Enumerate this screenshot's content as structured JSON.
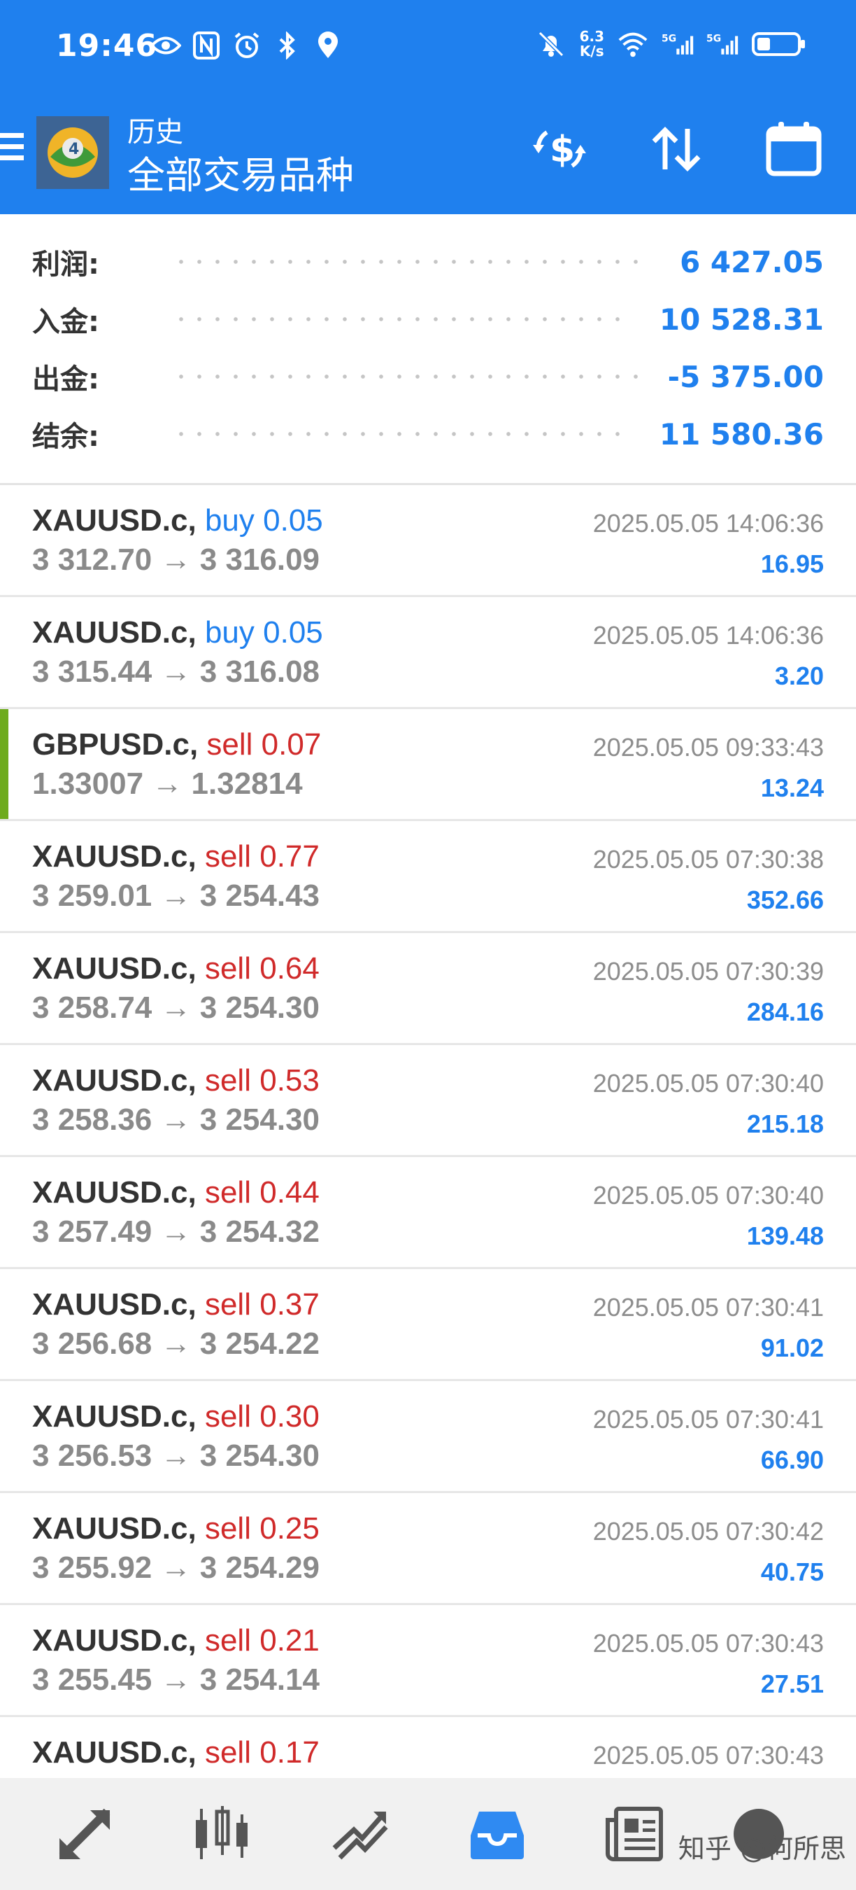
{
  "status_bar": {
    "time": "19:46",
    "left_icons": [
      "eye-icon",
      "nfc-icon",
      "alarm-icon",
      "bluetooth-icon",
      "location-icon"
    ],
    "network_speed": {
      "value": "6.3",
      "unit": "K/s"
    },
    "right_icons": [
      "mute-icon",
      "wifi-icon",
      "signal-5g-icon",
      "signal-5g-icon",
      "battery-icon"
    ]
  },
  "app_bar": {
    "title": "历史",
    "subtitle": "全部交易品种",
    "actions": [
      "currency-exchange-icon",
      "sort-icon",
      "calendar-icon"
    ]
  },
  "summary": [
    {
      "label": "利润:",
      "value": "6 427.05"
    },
    {
      "label": "入金:",
      "value": "10 528.31"
    },
    {
      "label": "出金:",
      "value": "-5 375.00"
    },
    {
      "label": "结余:",
      "value": "11 580.36"
    }
  ],
  "trades": [
    {
      "symbol": "XAUUSD.c,",
      "side": "buy",
      "volume": "0.05",
      "open": "3 312.70",
      "arrow": "→",
      "close": "3 316.09",
      "time": "2025.05.05 14:06:36",
      "profit": "16.95"
    },
    {
      "symbol": "XAUUSD.c,",
      "side": "buy",
      "volume": "0.05",
      "open": "3 315.44",
      "arrow": "→",
      "close": "3 316.08",
      "time": "2025.05.05 14:06:36",
      "profit": "3.20"
    },
    {
      "symbol": "GBPUSD.c,",
      "side": "sell",
      "volume": "0.07",
      "open": "1.33007",
      "arrow": "→",
      "close": "1.32814",
      "time": "2025.05.05 09:33:43",
      "profit": "13.24",
      "highlighted": true
    },
    {
      "symbol": "XAUUSD.c,",
      "side": "sell",
      "volume": "0.77",
      "open": "3 259.01",
      "arrow": "→",
      "close": "3 254.43",
      "time": "2025.05.05 07:30:38",
      "profit": "352.66"
    },
    {
      "symbol": "XAUUSD.c,",
      "side": "sell",
      "volume": "0.64",
      "open": "3 258.74",
      "arrow": "→",
      "close": "3 254.30",
      "time": "2025.05.05 07:30:39",
      "profit": "284.16"
    },
    {
      "symbol": "XAUUSD.c,",
      "side": "sell",
      "volume": "0.53",
      "open": "3 258.36",
      "arrow": "→",
      "close": "3 254.30",
      "time": "2025.05.05 07:30:40",
      "profit": "215.18"
    },
    {
      "symbol": "XAUUSD.c,",
      "side": "sell",
      "volume": "0.44",
      "open": "3 257.49",
      "arrow": "→",
      "close": "3 254.32",
      "time": "2025.05.05 07:30:40",
      "profit": "139.48"
    },
    {
      "symbol": "XAUUSD.c,",
      "side": "sell",
      "volume": "0.37",
      "open": "3 256.68",
      "arrow": "→",
      "close": "3 254.22",
      "time": "2025.05.05 07:30:41",
      "profit": "91.02"
    },
    {
      "symbol": "XAUUSD.c,",
      "side": "sell",
      "volume": "0.30",
      "open": "3 256.53",
      "arrow": "→",
      "close": "3 254.30",
      "time": "2025.05.05 07:30:41",
      "profit": "66.90"
    },
    {
      "symbol": "XAUUSD.c,",
      "side": "sell",
      "volume": "0.25",
      "open": "3 255.92",
      "arrow": "→",
      "close": "3 254.29",
      "time": "2025.05.05 07:30:42",
      "profit": "40.75"
    },
    {
      "symbol": "XAUUSD.c,",
      "side": "sell",
      "volume": "0.21",
      "open": "3 255.45",
      "arrow": "→",
      "close": "3 254.14",
      "time": "2025.05.05 07:30:43",
      "profit": "27.51"
    },
    {
      "symbol": "XAUUSD.c,",
      "side": "sell",
      "volume": "0.17",
      "open": "",
      "arrow": "",
      "close": "",
      "time": "2025.05.05 07:30:43",
      "profit": ""
    }
  ],
  "bottom_nav": {
    "items": [
      "quotes-icon",
      "chart-icon",
      "trade-icon",
      "history-icon",
      "news-icon",
      "chat-icon"
    ],
    "active": "history-icon",
    "watermark": "知乎 @何所思"
  },
  "colors": {
    "brand_blue": "#1f80ee",
    "sell_red": "#d02a2a",
    "accent_green": "#6eab1d"
  }
}
